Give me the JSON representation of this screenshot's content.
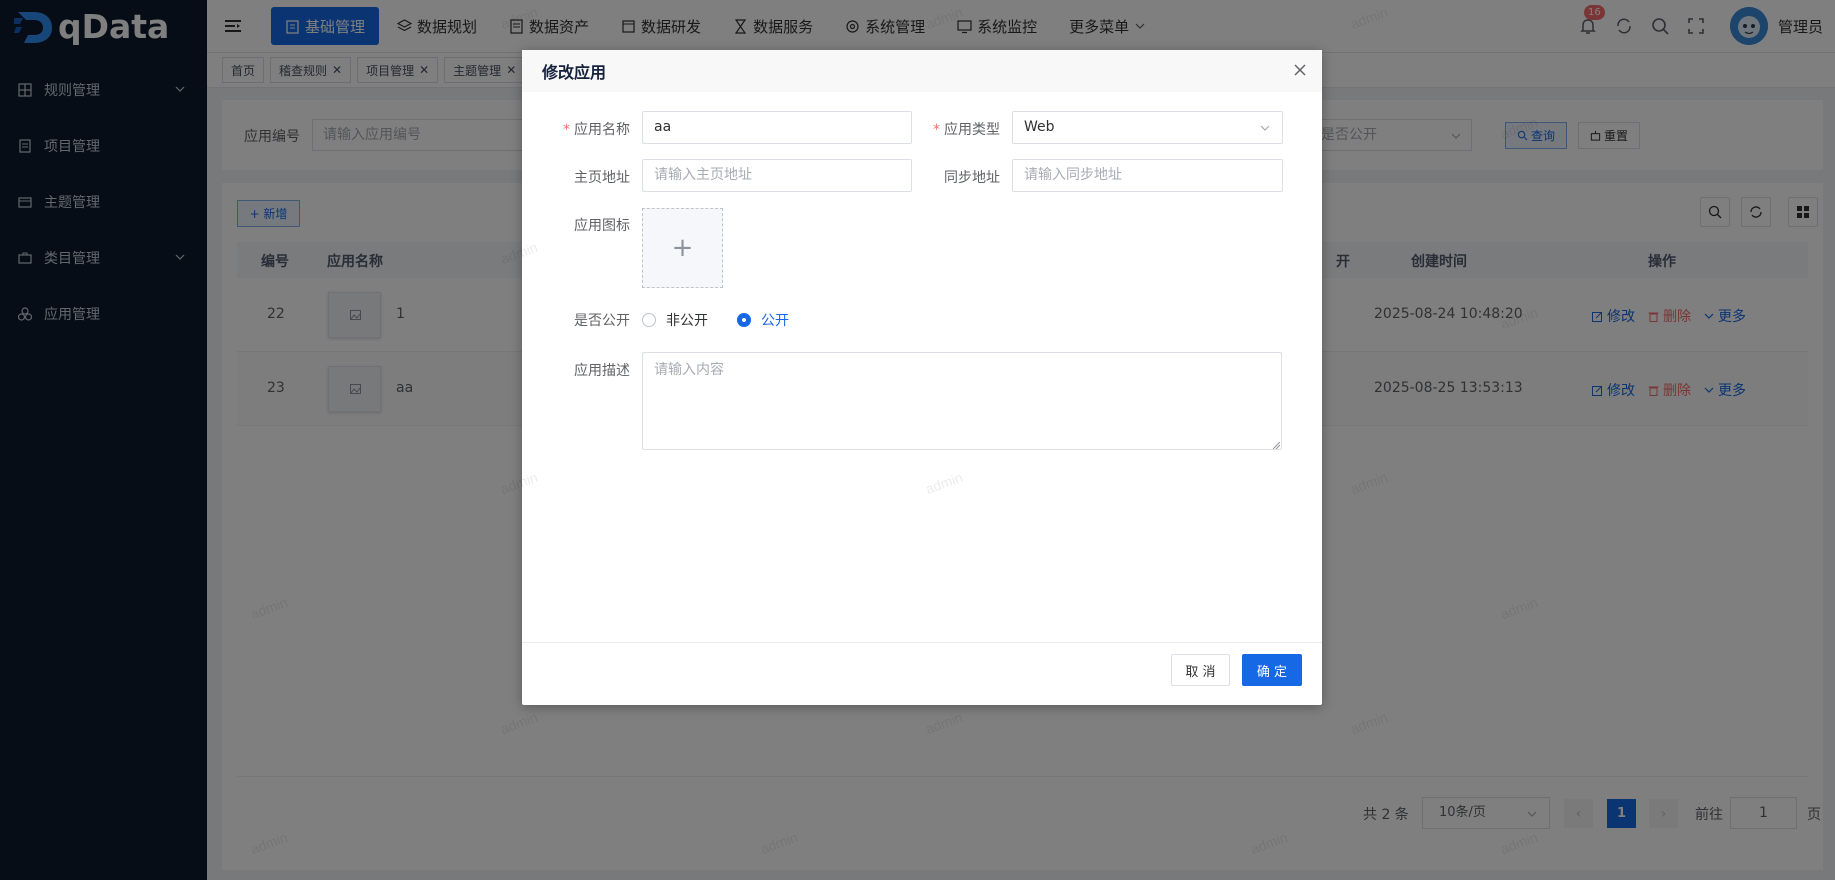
{
  "app": {
    "name": "qData"
  },
  "sidebar": {
    "items": [
      {
        "label": "规则管理",
        "icon": "grid-icon",
        "has_arrow": true
      },
      {
        "label": "项目管理",
        "icon": "document-icon",
        "has_arrow": false
      },
      {
        "label": "主题管理",
        "icon": "folder-icon",
        "has_arrow": false
      },
      {
        "label": "类目管理",
        "icon": "briefcase-icon",
        "has_arrow": true
      },
      {
        "label": "应用管理",
        "icon": "cluster-icon",
        "has_arrow": false
      }
    ]
  },
  "topnav": {
    "items": [
      {
        "label": "基础管理",
        "active": true
      },
      {
        "label": "数据规划",
        "active": false
      },
      {
        "label": "数据资产",
        "active": false
      },
      {
        "label": "数据研发",
        "active": false
      },
      {
        "label": "数据服务",
        "active": false
      },
      {
        "label": "系统管理",
        "active": false
      },
      {
        "label": "系统监控",
        "active": false
      },
      {
        "label": "更多菜单",
        "active": false
      }
    ],
    "notification_count": "16",
    "user_name": "管理员"
  },
  "tags": [
    {
      "label": "首页",
      "closable": false
    },
    {
      "label": "稽查规则",
      "closable": true
    },
    {
      "label": "项目管理",
      "closable": true
    },
    {
      "label": "主题管理",
      "closable": true
    }
  ],
  "search": {
    "label": "应用编号",
    "placeholder": "请输入应用编号",
    "public_placeholder": "是否公开",
    "query_label": "查询",
    "reset_label": "重置"
  },
  "table": {
    "add_label": "+ 新增",
    "headers": {
      "id": "编号",
      "name": "应用名称",
      "public": "开",
      "created": "创建时间",
      "ops": "操作"
    },
    "rows": [
      {
        "id": "22",
        "name": "1",
        "created": "2025-08-24 10:48:20"
      },
      {
        "id": "23",
        "name": "aa",
        "created": "2025-08-25 13:53:13"
      }
    ],
    "actions": {
      "edit": "修改",
      "delete": "删除",
      "more": "更多"
    }
  },
  "pager": {
    "total": "共 2 条",
    "page_size": "10条/页",
    "current_page": "1",
    "goto_label": "前往",
    "goto_value": "1",
    "page_suffix": "页"
  },
  "dialog": {
    "title": "修改应用",
    "name_label": "应用名称",
    "name_value": "aa",
    "type_label": "应用类型",
    "type_value": "Web",
    "home_label": "主页地址",
    "home_placeholder": "请输入主页地址",
    "sync_label": "同步地址",
    "sync_placeholder": "请输入同步地址",
    "icon_label": "应用图标",
    "public_label": "是否公开",
    "public_options": [
      "非公开",
      "公开"
    ],
    "public_selected": "公开",
    "desc_label": "应用描述",
    "desc_placeholder": "请输入内容",
    "cancel_label": "取 消",
    "ok_label": "确 定"
  },
  "watermark": "admin",
  "colors": {
    "primary": "#1768e5",
    "sidebar": "#0c1a2d",
    "danger": "#f56c6c"
  }
}
